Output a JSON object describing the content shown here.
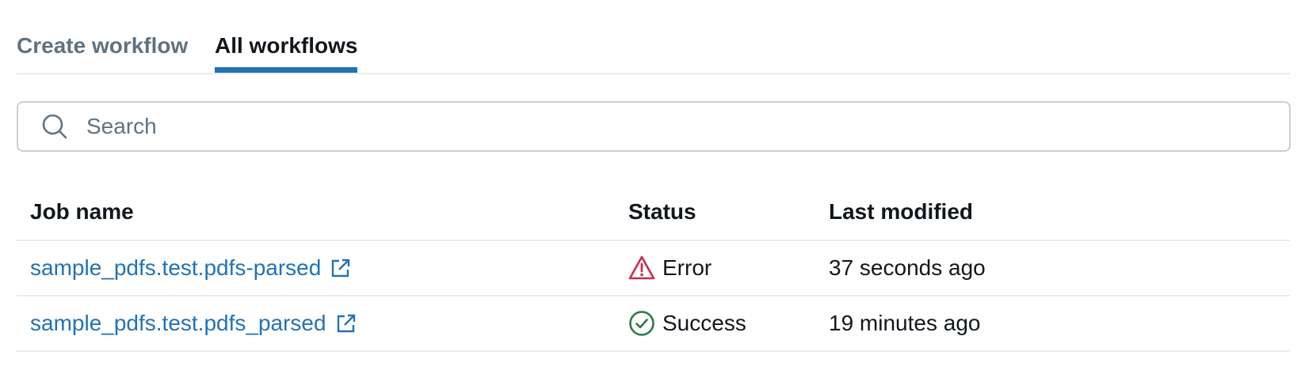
{
  "tabs": [
    {
      "label": "Create workflow",
      "active": false
    },
    {
      "label": "All workflows",
      "active": true
    }
  ],
  "search": {
    "placeholder": "Search",
    "value": "",
    "icon": "search-icon"
  },
  "table": {
    "columns": [
      "Job name",
      "Status",
      "Last modified"
    ],
    "rows": [
      {
        "job_name": "sample_pdfs.test.pdfs-parsed",
        "status": "Error",
        "status_icon": "warning-triangle-icon",
        "last_modified": "37 seconds ago"
      },
      {
        "job_name": "sample_pdfs.test.pdfs_parsed",
        "status": "Success",
        "status_icon": "check-circle-icon",
        "last_modified": "19 minutes ago"
      }
    ]
  },
  "colors": {
    "accent": "#2272b4",
    "error": "#c82d4c",
    "success": "#277c43",
    "muted_text": "#5f7281",
    "border": "#e8ecf0"
  }
}
